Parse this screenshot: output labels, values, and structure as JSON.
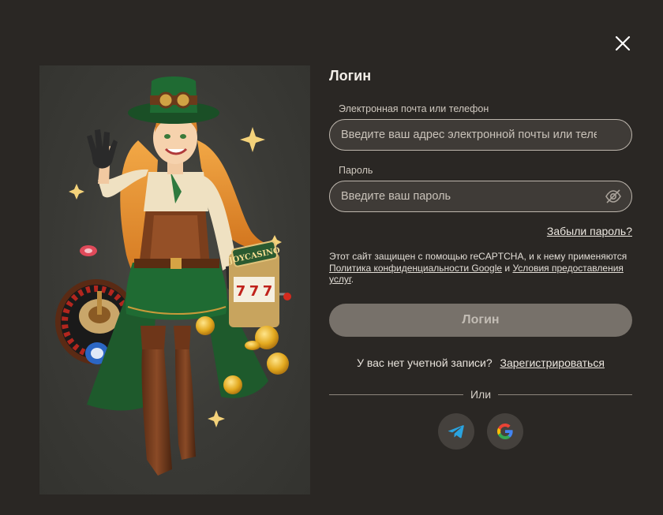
{
  "modal": {
    "close_icon": "close-icon",
    "title": "Логин"
  },
  "form": {
    "email_label": "Электронная почта или телефон",
    "email_placeholder": "Введите ваш адрес электронной почты или телефон",
    "password_label": "Пароль",
    "password_placeholder": "Введите ваш пароль",
    "password_toggle_icon": "eye-slash-icon",
    "forgot_password": "Забыли пароль?",
    "recaptcha_text_1": "Этот сайт защищен с помощью reCAPTCHA, и к нему применяются",
    "privacy_link": "Политика конфиденциальности Google",
    "recaptcha_and": "и",
    "terms_link": "Условия предоставления услуг",
    "recaptcha_end": ".",
    "login_button": "Логин",
    "no_account": "У вас нет учетной записи?",
    "register_link": "Зарегистрироваться",
    "or_divider": "Или"
  },
  "social": [
    {
      "name": "telegram",
      "icon": "telegram-icon",
      "color": "#2aa3df"
    },
    {
      "name": "google",
      "icon": "google-icon"
    }
  ],
  "illustration": {
    "slot_brand": "JOYCASINO",
    "slot_reels": [
      "7",
      "7",
      "7"
    ]
  },
  "colors": {
    "background": "#2a2724",
    "input_bg": "#3f3b37",
    "button_disabled": "#77716a",
    "hat_green": "#1f5e2e"
  }
}
